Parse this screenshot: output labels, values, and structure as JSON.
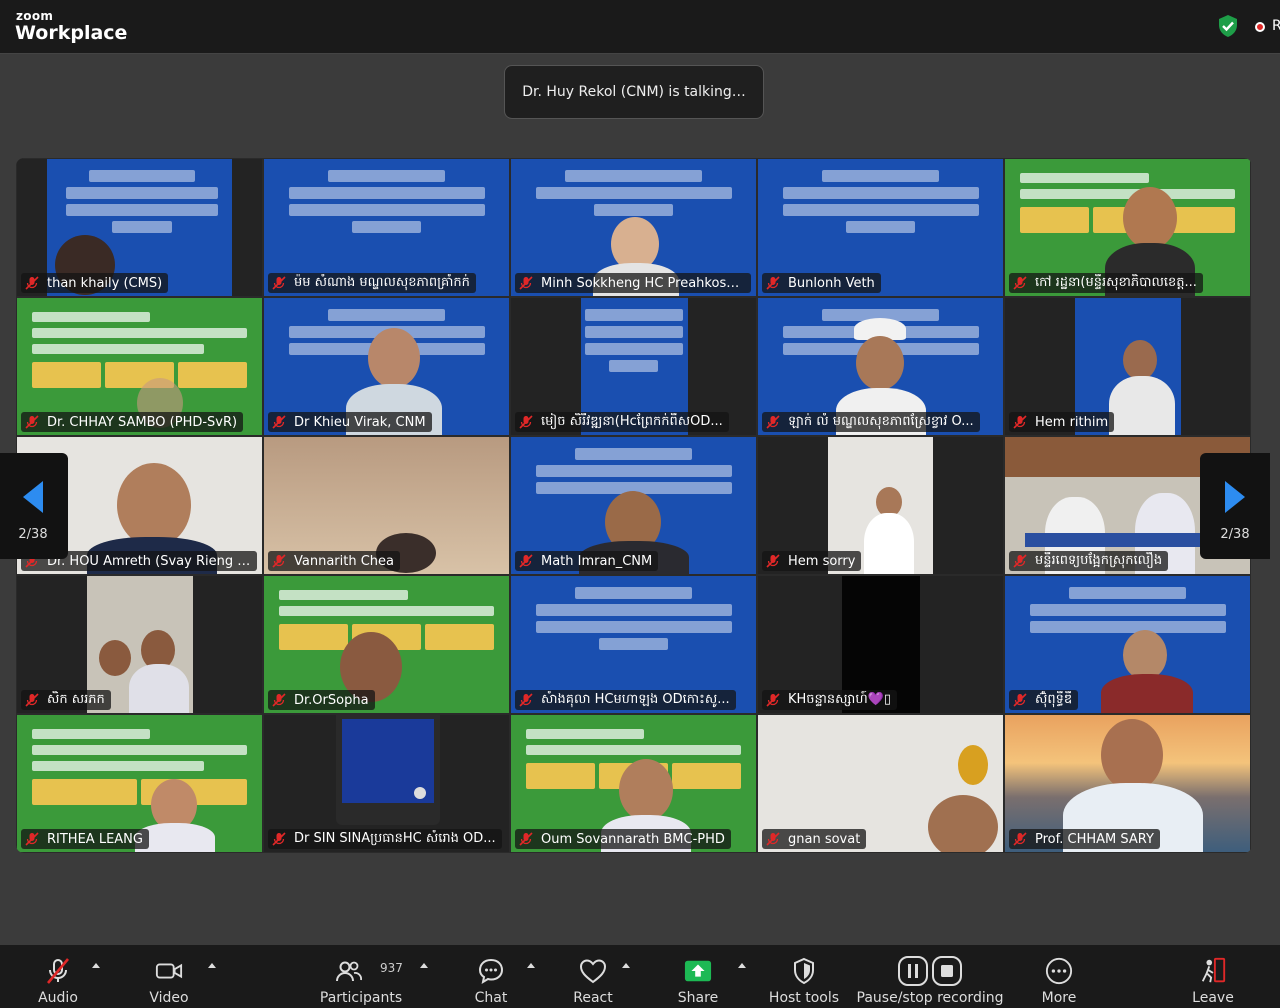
{
  "header": {
    "logo_small": "zoom",
    "logo_big": "Workplace",
    "recording_letter": "R"
  },
  "talking_banner": "Dr. Huy Rekol (CNM) is talking…",
  "participants": [
    {
      "name": "than khaily (CMS)"
    },
    {
      "name": "ម៉ម សំណាង មណ្ឌលសុខភាពគ្រាំកក់"
    },
    {
      "name": "Minh Sokkheng HC Preahkosom..."
    },
    {
      "name": "Bunlonh Veth"
    },
    {
      "name": "កៅ រដ្ឋនា(មន្ទីរសុខាភិបាលខេត្ត..."
    },
    {
      "name": "Dr. CHHAY SAMBO (PHD-SvR)"
    },
    {
      "name": "Dr Khieu Virak, CNM"
    },
    {
      "name": "មៀច សិរីវឌ្ឍនា(Hcព្រែកក់ពីសOD..."
    },
    {
      "name": "ឡាក់ លំ មណ្ឌលសុខភាពស្រែខ្វាវ O..."
    },
    {
      "name": "Hem rithim"
    },
    {
      "name": "Dr. HOU Amreth (Svay Rieng RH)"
    },
    {
      "name": "Vannarith Chea"
    },
    {
      "name": "Math Imran_CNM"
    },
    {
      "name": "Hem sorry"
    },
    {
      "name": "មន្ទីរពេទ្យបង្អែកស្រុកលឿង"
    },
    {
      "name": "សិក សរភក"
    },
    {
      "name": "Dr.OrSopha"
    },
    {
      "name": "សំាងគុលា HCមហាឡង ODកោះសូ..."
    },
    {
      "name": "KHចន្ទានស្សាហ៍💜▯"
    },
    {
      "name": "ស៊ុំពុទ្ធីឌី"
    },
    {
      "name": "RITHEA LEANG"
    },
    {
      "name": "Dr SIN SINAប្រធានHC សំរោង OD..."
    },
    {
      "name": "Oum Sovannarath BMC-PHD"
    },
    {
      "name": "gnan sovat"
    },
    {
      "name": "Prof. CHHAM SARY"
    }
  ],
  "pagination": {
    "left": "2/38",
    "right": "2/38"
  },
  "toolbar": {
    "audio": "Audio",
    "video": "Video",
    "participants": "Participants",
    "participants_count": "937",
    "chat": "Chat",
    "react": "React",
    "share": "Share",
    "host_tools": "Host tools",
    "pause_stop": "Pause/stop recording",
    "more": "More",
    "leave": "Leave"
  },
  "colors": {
    "accent": "#2d8cf0",
    "share_green": "#1db954",
    "mute_red": "#e02828",
    "shield_green": "#1e9e48",
    "slide_blue": "#1a4fb0",
    "slide_green": "#3b9a3a"
  }
}
